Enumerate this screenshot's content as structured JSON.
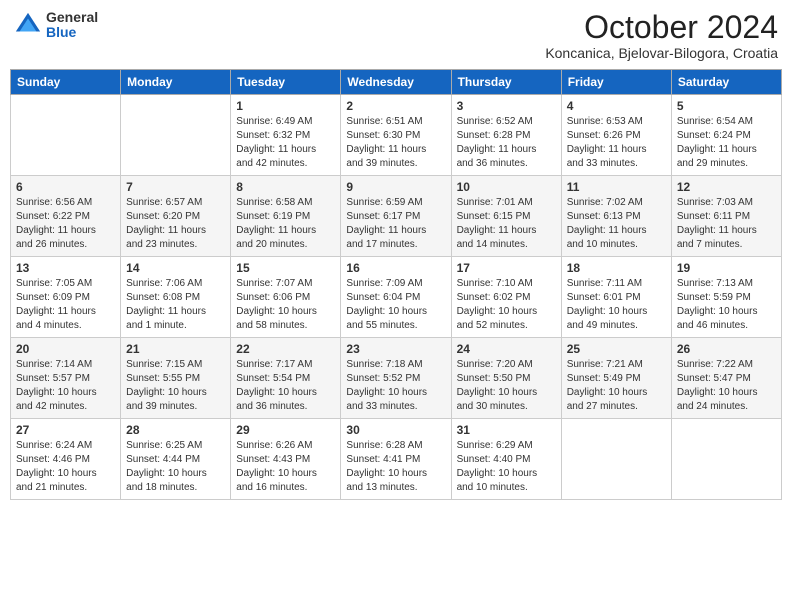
{
  "header": {
    "logo_general": "General",
    "logo_blue": "Blue",
    "month_title": "October 2024",
    "location": "Koncanica, Bjelovar-Bilogora, Croatia"
  },
  "weekdays": [
    "Sunday",
    "Monday",
    "Tuesday",
    "Wednesday",
    "Thursday",
    "Friday",
    "Saturday"
  ],
  "weeks": [
    [
      {
        "day": "",
        "sunrise": "",
        "sunset": "",
        "daylight": ""
      },
      {
        "day": "",
        "sunrise": "",
        "sunset": "",
        "daylight": ""
      },
      {
        "day": "1",
        "sunrise": "Sunrise: 6:49 AM",
        "sunset": "Sunset: 6:32 PM",
        "daylight": "Daylight: 11 hours and 42 minutes."
      },
      {
        "day": "2",
        "sunrise": "Sunrise: 6:51 AM",
        "sunset": "Sunset: 6:30 PM",
        "daylight": "Daylight: 11 hours and 39 minutes."
      },
      {
        "day": "3",
        "sunrise": "Sunrise: 6:52 AM",
        "sunset": "Sunset: 6:28 PM",
        "daylight": "Daylight: 11 hours and 36 minutes."
      },
      {
        "day": "4",
        "sunrise": "Sunrise: 6:53 AM",
        "sunset": "Sunset: 6:26 PM",
        "daylight": "Daylight: 11 hours and 33 minutes."
      },
      {
        "day": "5",
        "sunrise": "Sunrise: 6:54 AM",
        "sunset": "Sunset: 6:24 PM",
        "daylight": "Daylight: 11 hours and 29 minutes."
      }
    ],
    [
      {
        "day": "6",
        "sunrise": "Sunrise: 6:56 AM",
        "sunset": "Sunset: 6:22 PM",
        "daylight": "Daylight: 11 hours and 26 minutes."
      },
      {
        "day": "7",
        "sunrise": "Sunrise: 6:57 AM",
        "sunset": "Sunset: 6:20 PM",
        "daylight": "Daylight: 11 hours and 23 minutes."
      },
      {
        "day": "8",
        "sunrise": "Sunrise: 6:58 AM",
        "sunset": "Sunset: 6:19 PM",
        "daylight": "Daylight: 11 hours and 20 minutes."
      },
      {
        "day": "9",
        "sunrise": "Sunrise: 6:59 AM",
        "sunset": "Sunset: 6:17 PM",
        "daylight": "Daylight: 11 hours and 17 minutes."
      },
      {
        "day": "10",
        "sunrise": "Sunrise: 7:01 AM",
        "sunset": "Sunset: 6:15 PM",
        "daylight": "Daylight: 11 hours and 14 minutes."
      },
      {
        "day": "11",
        "sunrise": "Sunrise: 7:02 AM",
        "sunset": "Sunset: 6:13 PM",
        "daylight": "Daylight: 11 hours and 10 minutes."
      },
      {
        "day": "12",
        "sunrise": "Sunrise: 7:03 AM",
        "sunset": "Sunset: 6:11 PM",
        "daylight": "Daylight: 11 hours and 7 minutes."
      }
    ],
    [
      {
        "day": "13",
        "sunrise": "Sunrise: 7:05 AM",
        "sunset": "Sunset: 6:09 PM",
        "daylight": "Daylight: 11 hours and 4 minutes."
      },
      {
        "day": "14",
        "sunrise": "Sunrise: 7:06 AM",
        "sunset": "Sunset: 6:08 PM",
        "daylight": "Daylight: 11 hours and 1 minute."
      },
      {
        "day": "15",
        "sunrise": "Sunrise: 7:07 AM",
        "sunset": "Sunset: 6:06 PM",
        "daylight": "Daylight: 10 hours and 58 minutes."
      },
      {
        "day": "16",
        "sunrise": "Sunrise: 7:09 AM",
        "sunset": "Sunset: 6:04 PM",
        "daylight": "Daylight: 10 hours and 55 minutes."
      },
      {
        "day": "17",
        "sunrise": "Sunrise: 7:10 AM",
        "sunset": "Sunset: 6:02 PM",
        "daylight": "Daylight: 10 hours and 52 minutes."
      },
      {
        "day": "18",
        "sunrise": "Sunrise: 7:11 AM",
        "sunset": "Sunset: 6:01 PM",
        "daylight": "Daylight: 10 hours and 49 minutes."
      },
      {
        "day": "19",
        "sunrise": "Sunrise: 7:13 AM",
        "sunset": "Sunset: 5:59 PM",
        "daylight": "Daylight: 10 hours and 46 minutes."
      }
    ],
    [
      {
        "day": "20",
        "sunrise": "Sunrise: 7:14 AM",
        "sunset": "Sunset: 5:57 PM",
        "daylight": "Daylight: 10 hours and 42 minutes."
      },
      {
        "day": "21",
        "sunrise": "Sunrise: 7:15 AM",
        "sunset": "Sunset: 5:55 PM",
        "daylight": "Daylight: 10 hours and 39 minutes."
      },
      {
        "day": "22",
        "sunrise": "Sunrise: 7:17 AM",
        "sunset": "Sunset: 5:54 PM",
        "daylight": "Daylight: 10 hours and 36 minutes."
      },
      {
        "day": "23",
        "sunrise": "Sunrise: 7:18 AM",
        "sunset": "Sunset: 5:52 PM",
        "daylight": "Daylight: 10 hours and 33 minutes."
      },
      {
        "day": "24",
        "sunrise": "Sunrise: 7:20 AM",
        "sunset": "Sunset: 5:50 PM",
        "daylight": "Daylight: 10 hours and 30 minutes."
      },
      {
        "day": "25",
        "sunrise": "Sunrise: 7:21 AM",
        "sunset": "Sunset: 5:49 PM",
        "daylight": "Daylight: 10 hours and 27 minutes."
      },
      {
        "day": "26",
        "sunrise": "Sunrise: 7:22 AM",
        "sunset": "Sunset: 5:47 PM",
        "daylight": "Daylight: 10 hours and 24 minutes."
      }
    ],
    [
      {
        "day": "27",
        "sunrise": "Sunrise: 6:24 AM",
        "sunset": "Sunset: 4:46 PM",
        "daylight": "Daylight: 10 hours and 21 minutes."
      },
      {
        "day": "28",
        "sunrise": "Sunrise: 6:25 AM",
        "sunset": "Sunset: 4:44 PM",
        "daylight": "Daylight: 10 hours and 18 minutes."
      },
      {
        "day": "29",
        "sunrise": "Sunrise: 6:26 AM",
        "sunset": "Sunset: 4:43 PM",
        "daylight": "Daylight: 10 hours and 16 minutes."
      },
      {
        "day": "30",
        "sunrise": "Sunrise: 6:28 AM",
        "sunset": "Sunset: 4:41 PM",
        "daylight": "Daylight: 10 hours and 13 minutes."
      },
      {
        "day": "31",
        "sunrise": "Sunrise: 6:29 AM",
        "sunset": "Sunset: 4:40 PM",
        "daylight": "Daylight: 10 hours and 10 minutes."
      },
      {
        "day": "",
        "sunrise": "",
        "sunset": "",
        "daylight": ""
      },
      {
        "day": "",
        "sunrise": "",
        "sunset": "",
        "daylight": ""
      }
    ]
  ]
}
